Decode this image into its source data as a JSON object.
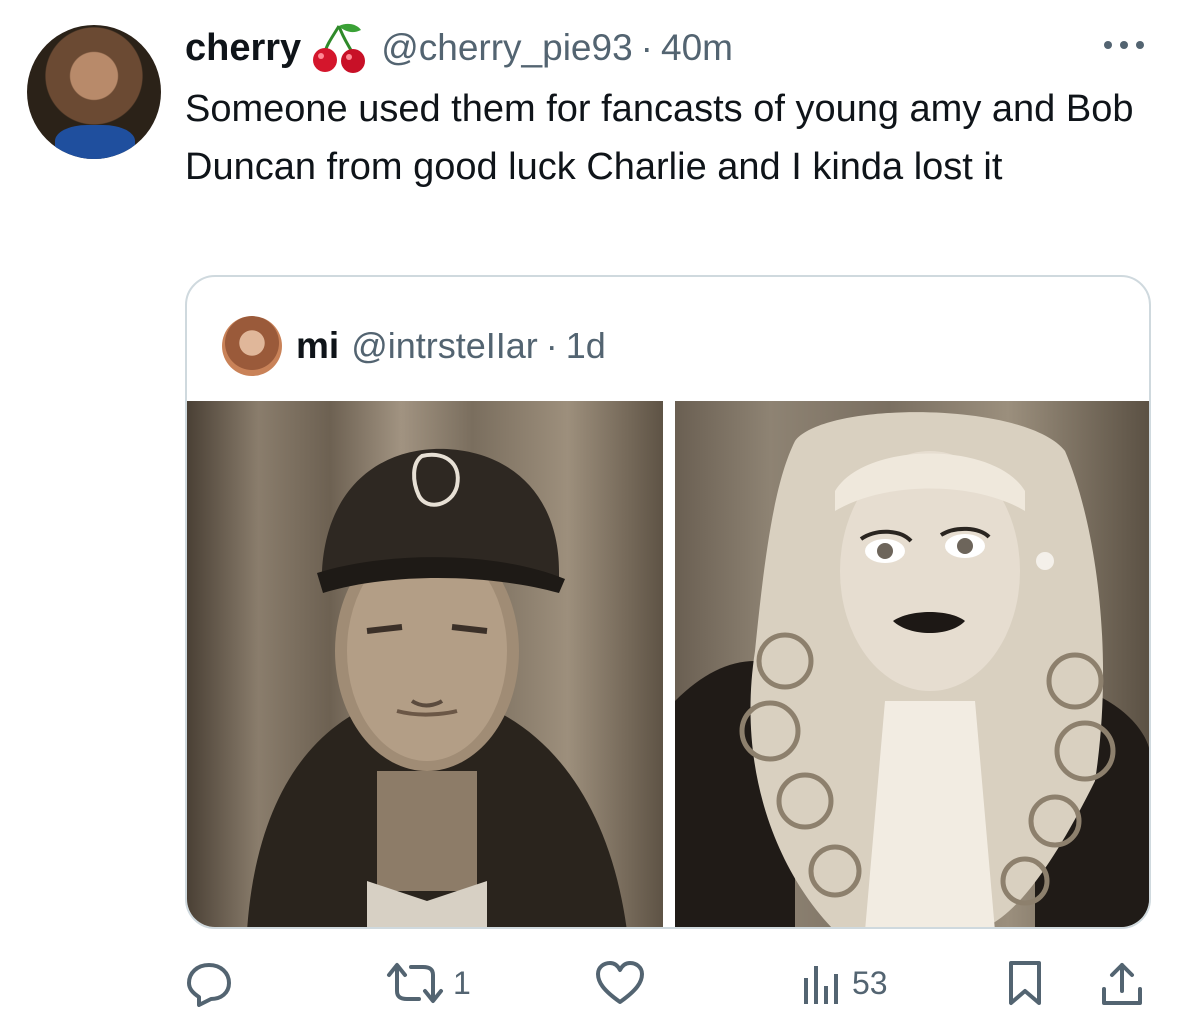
{
  "tweet": {
    "display_name": "cherry",
    "name_emoji": "cherry-icon",
    "handle": "@cherry_pie93",
    "separator": "·",
    "time": "40m",
    "text": "Someone used them for fancasts of young amy and Bob Duncan from good luck Charlie and I kinda lost it"
  },
  "quote": {
    "display_name": "mi",
    "handle": "@intrsteIIar",
    "separator": "·",
    "time": "1d",
    "media": [
      {
        "description_icon": "photo-man-in-cap"
      },
      {
        "description_icon": "photo-woman-curls"
      }
    ]
  },
  "actions": {
    "reply": {
      "icon": "reply-icon"
    },
    "retweet": {
      "icon": "retweet-icon",
      "count": "1"
    },
    "like": {
      "icon": "like-icon"
    },
    "views": {
      "icon": "views-icon",
      "count": "53"
    },
    "bookmark": {
      "icon": "bookmark-icon"
    },
    "share": {
      "icon": "share-icon"
    }
  },
  "colors": {
    "text_primary": "#0f1419",
    "text_secondary": "#536471",
    "border": "#cfd9de"
  }
}
